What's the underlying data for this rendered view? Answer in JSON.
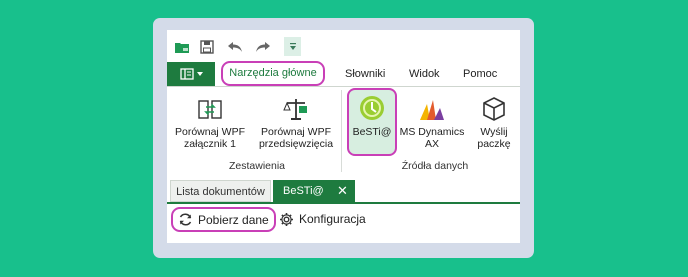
{
  "ribbon_tabs": {
    "narzedzia": "Narzędzia główne",
    "slowniki": "Słowniki",
    "widok": "Widok",
    "pomoc": "Pomoc"
  },
  "groups": {
    "zestawienia": {
      "label": "Zestawienia",
      "buttons": [
        {
          "line1": "Porównaj WPF",
          "line2": "załącznik 1",
          "icon": "compare-icon"
        },
        {
          "line1": "Porównaj WPF",
          "line2": "przedsięwzięcia",
          "icon": "scale-icon"
        }
      ]
    },
    "zrodla": {
      "label": "Źródła danych",
      "buttons": [
        {
          "line1": "BeSTi@",
          "icon": "besti-icon"
        },
        {
          "line1": "MS Dynamics",
          "line2": "AX",
          "icon": "ms-dynamics-icon"
        },
        {
          "line1": "Wyślij",
          "line2": "paczkę",
          "icon": "package-icon"
        }
      ]
    }
  },
  "doc_tabs": {
    "lista": "Lista dokumentów",
    "besti": "BeSTi@",
    "close": "✕"
  },
  "actions": {
    "pobierz": "Pobierz dane",
    "konfiguracja": "Konfiguracja"
  },
  "colors": {
    "accent_green": "#1e7b3f",
    "highlight_magenta": "#c93fb7",
    "background": "#18c08c"
  }
}
